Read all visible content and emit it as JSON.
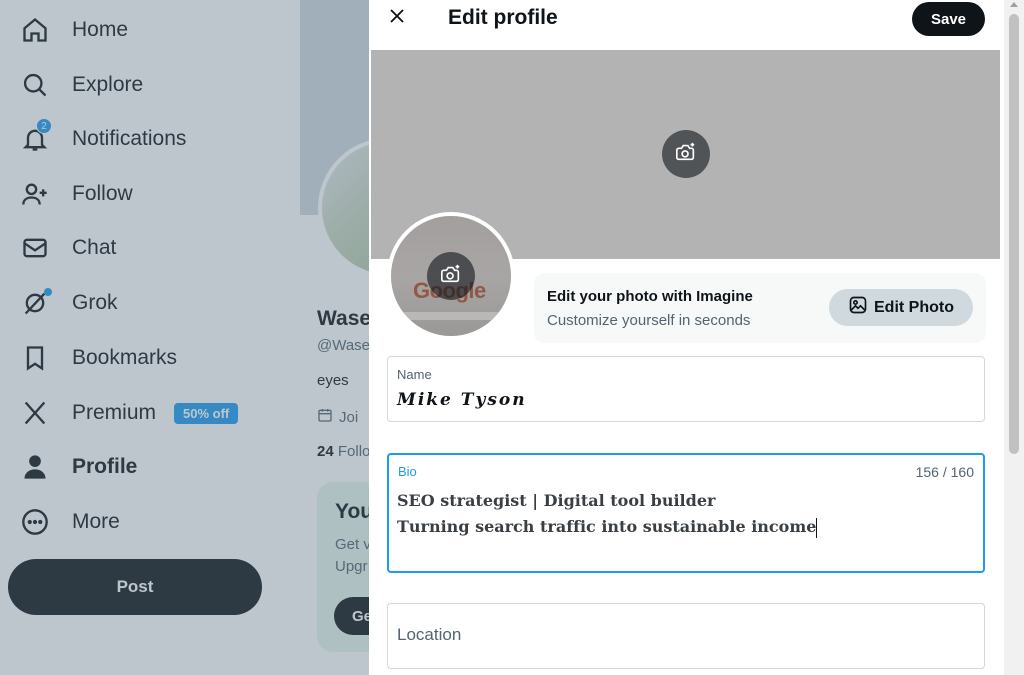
{
  "sidebar": {
    "items": [
      {
        "label": "Home",
        "icon": "home-icon"
      },
      {
        "label": "Explore",
        "icon": "search-icon"
      },
      {
        "label": "Notifications",
        "icon": "bell-icon",
        "badge": "2"
      },
      {
        "label": "Follow",
        "icon": "person-add-icon"
      },
      {
        "label": "Chat",
        "icon": "envelope-icon"
      },
      {
        "label": "Grok",
        "icon": "grok-icon"
      },
      {
        "label": "Bookmarks",
        "icon": "bookmark-icon"
      },
      {
        "label": "Premium",
        "icon": "x-logo-icon",
        "badge": "50% off"
      },
      {
        "label": "Profile",
        "icon": "person-icon"
      },
      {
        "label": "More",
        "icon": "more-circle-icon"
      }
    ],
    "post_label": "Post"
  },
  "background_profile": {
    "name": "Wase",
    "handle": "@Wase",
    "bio": "eyes",
    "joined": "Joi",
    "following_count": "24",
    "following_label": "Follo",
    "card_title": "You",
    "card_line1": "Get v",
    "card_line2": "Upgr",
    "card_button": "Ge"
  },
  "modal": {
    "title": "Edit profile",
    "save_label": "Save",
    "imagine_title": "Edit your photo with Imagine",
    "imagine_subtitle": "Customize yourself in seconds",
    "edit_photo_label": "Edit Photo",
    "avatar_logo_text": "Google",
    "name_field": {
      "label": "Name",
      "value": "𝑴𝒊𝒌𝒆 𝑻𝒚𝒔𝒐𝒏"
    },
    "bio_field": {
      "label": "Bio",
      "count": "156 / 160",
      "line1": "𝐒𝐄𝐎 𝐬𝐭𝐫𝐚𝐭𝐞𝐠𝐢𝐬𝐭 | 𝐃𝐢𝐠𝐢𝐭𝐚𝐥 𝐭𝐨𝐨𝐥 𝐛𝐮𝐢𝐥𝐝𝐞𝐫",
      "line2": "𝐓𝐮𝐫𝐧𝐢𝐧𝐠 𝐬𝐞𝐚𝐫𝐜𝐡 𝐭𝐫𝐚𝐟𝐟𝐢𝐜 𝐢𝐧𝐭𝐨 𝐬𝐮𝐬𝐭𝐚𝐢𝐧𝐚𝐛𝐥𝐞 𝐢𝐧𝐜𝐨𝐦𝐞"
    },
    "location_field": {
      "placeholder": "Location"
    }
  },
  "colors": {
    "accent": "#1d9bf0",
    "text": "#0f1419",
    "muted": "#536471",
    "banner": "#b3b3b3"
  }
}
